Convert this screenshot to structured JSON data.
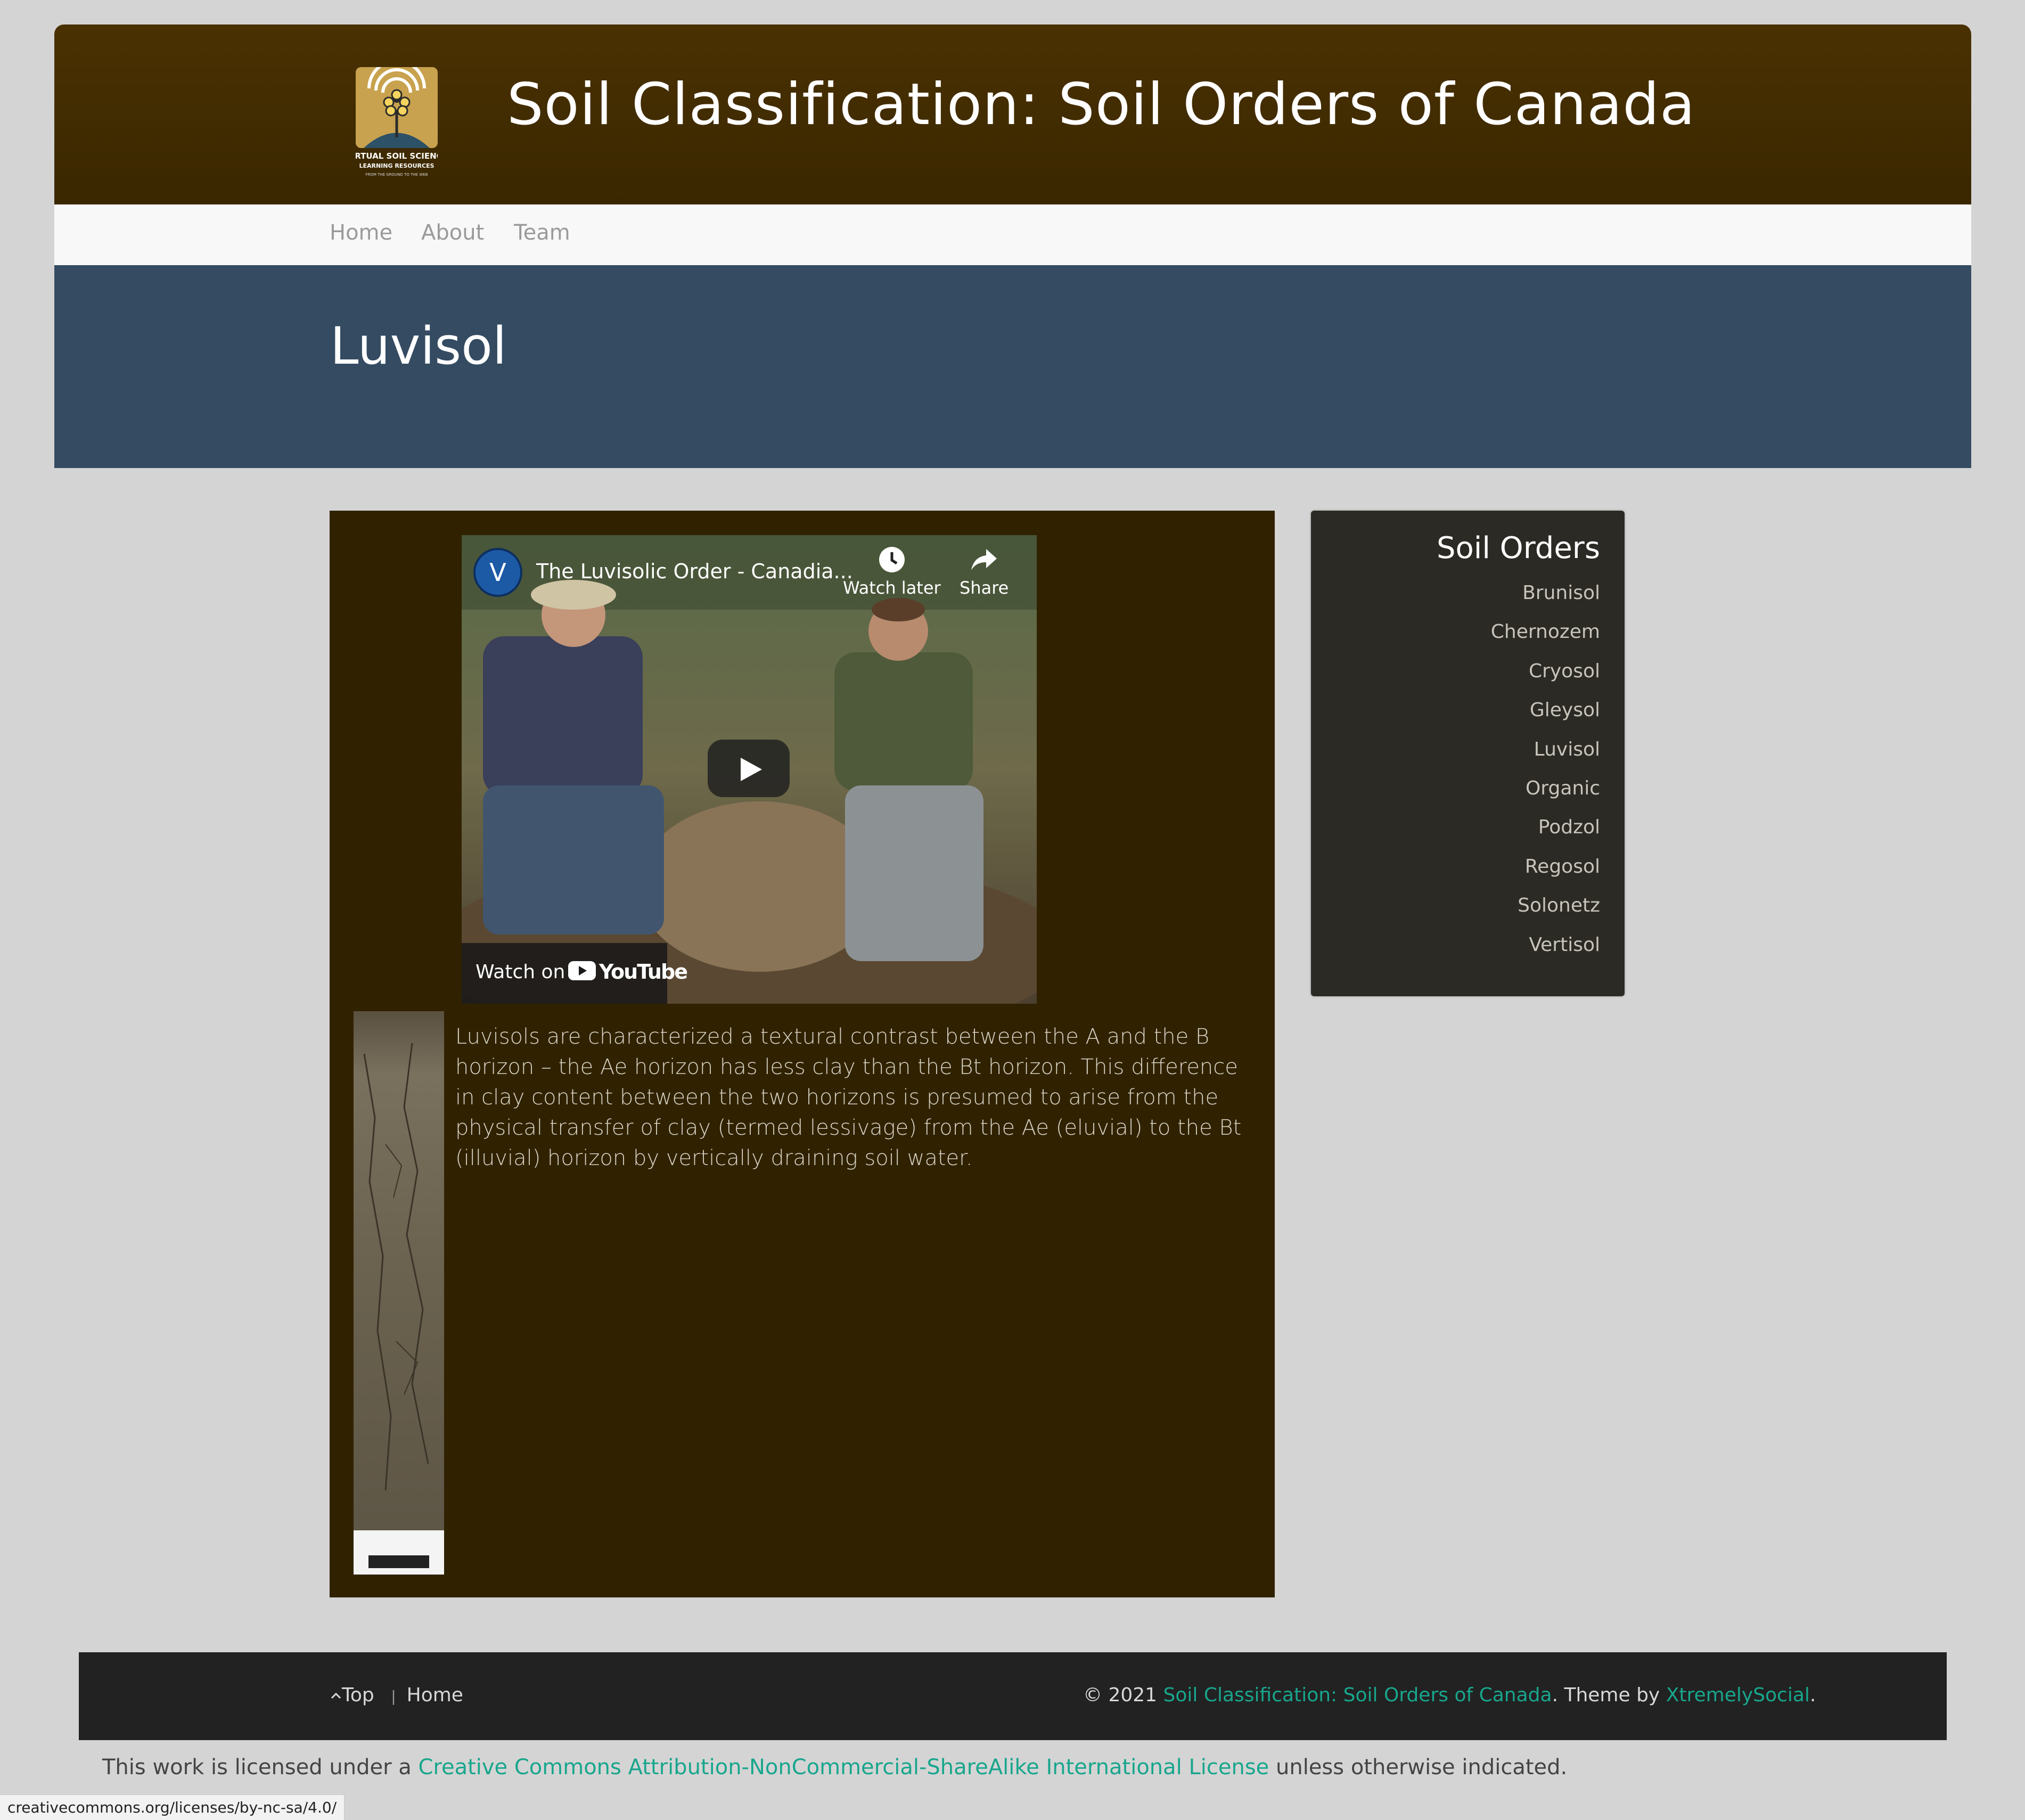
{
  "header": {
    "site_title": "Soil Classification: Soil Orders of Canada",
    "logo": {
      "line1": "VIRTUAL SOIL SCIENCE",
      "line2": "LEARNING RESOURCES",
      "line3": "FROM THE GROUND TO THE WEB"
    }
  },
  "nav": {
    "items": [
      "Home",
      "About",
      "Team"
    ]
  },
  "hero": {
    "title": "Luvisol"
  },
  "video": {
    "avatar_letter": "V",
    "title": "The Luvisolic Order - Canadia...",
    "watch_later": "Watch later",
    "share": "Share",
    "watch_on": "Watch on",
    "youtube": "YouTube"
  },
  "content": {
    "intro": "Luvisols are characterized a textural contrast between the A and the B horizon – the Ae horizon has less clay than the Bt horizon. This difference in clay content between the two horizons is presumed to arise from the physical transfer of clay (termed lessivage) from the Ae (eluvial) to the Bt (illuvial) horizon by vertically draining soil water."
  },
  "sidebar": {
    "title": "Soil Orders",
    "items": [
      "Brunisol",
      "Chernozem",
      "Cryosol",
      "Gleysol",
      "Luvisol",
      "Organic",
      "Podzol",
      "Regosol",
      "Solonetz",
      "Vertisol"
    ]
  },
  "footer": {
    "top_label": "Top",
    "home_label": "Home",
    "separator": "|",
    "copyright_prefix": "© 2021",
    "site_link": "Soil Classification: Soil Orders of Canada",
    "theme_by": ". Theme by",
    "theme_link": "XtremelySocial",
    "period": "."
  },
  "license": {
    "prefix": "This work is licensed under a",
    "link": "Creative Commons Attribution-NonCommercial-ShareAlike International License",
    "suffix": "unless otherwise indicated."
  },
  "status_bar": {
    "url": "creativecommons.org/licenses/by-nc-sa/4.0/"
  },
  "colors": {
    "header": "#3e2a00",
    "hero": "#344b62",
    "content_bg": "#302200",
    "sidebar_bg": "#2c2a24",
    "link": "#18a68d",
    "footer": "#222222"
  }
}
